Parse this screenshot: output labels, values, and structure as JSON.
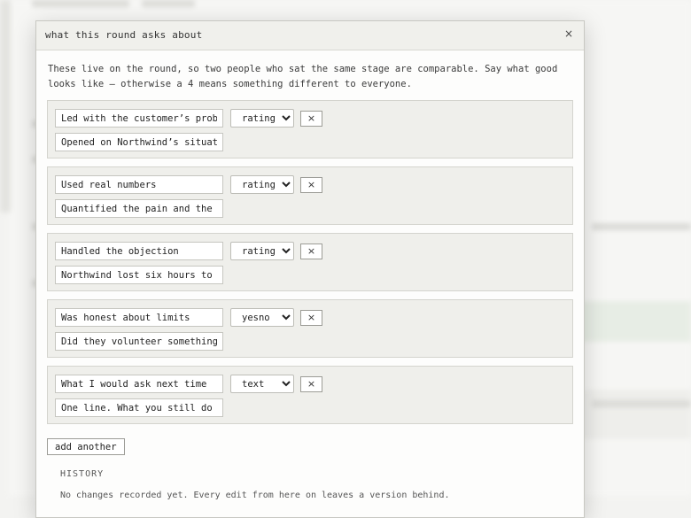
{
  "modal": {
    "title": "what this round asks about",
    "close_label": "×",
    "intro": "These live on the round, so two people who sat the same stage are comparable. Say what good looks like — otherwise a 4 means something different to everyone."
  },
  "questions": [
    {
      "label": "Led with the customer’s problem",
      "description": "Opened on Northwind’s situation",
      "type": "rating",
      "remove_label": "×"
    },
    {
      "label": "Used real numbers",
      "description": "Quantified the pain and the gain",
      "type": "rating",
      "remove_label": "×"
    },
    {
      "label": "Handled the objection",
      "description": "Northwind lost six hours to",
      "type": "rating",
      "remove_label": "×"
    },
    {
      "label": "Was honest about limits",
      "description": "Did they volunteer something",
      "type": "yesno",
      "remove_label": "×"
    },
    {
      "label": "What I would ask next time",
      "description": "One line. What you still do",
      "type": "text",
      "remove_label": "×"
    }
  ],
  "type_options": [
    "rating",
    "yesno",
    "text"
  ],
  "add_label": "add another",
  "history": {
    "heading": "HISTORY",
    "empty_text": "No changes recorded yet. Every edit from here on leaves a version behind."
  }
}
